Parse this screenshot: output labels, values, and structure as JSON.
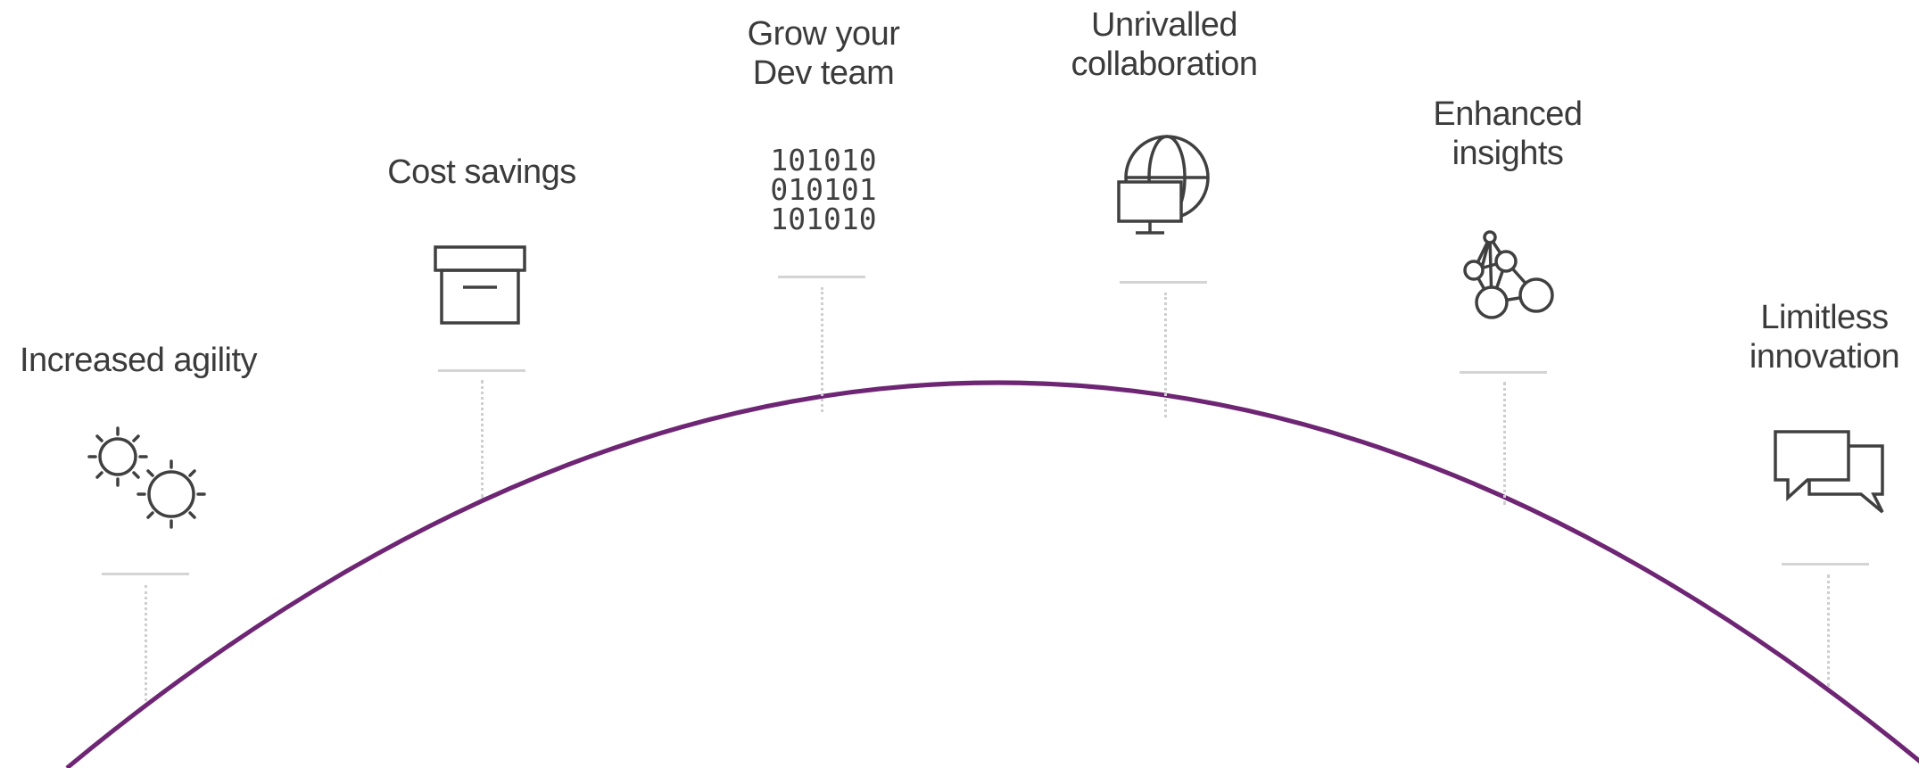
{
  "colors": {
    "arc": "#6e2574",
    "icon": "#404040",
    "connector": "#d4d4d4",
    "text": "#3b3b3b"
  },
  "benefits": [
    {
      "lines": [
        "Increased agility"
      ],
      "icon": "gears-icon"
    },
    {
      "lines": [
        "Cost savings"
      ],
      "icon": "archive-box-icon"
    },
    {
      "lines": [
        "Grow your",
        "Dev team"
      ],
      "icon": "binary-code-icon"
    },
    {
      "lines": [
        "Unrivalled",
        "collaboration"
      ],
      "icon": "globe-monitor-icon"
    },
    {
      "lines": [
        "Enhanced",
        "insights"
      ],
      "icon": "network-nodes-icon"
    },
    {
      "lines": [
        "Limitless",
        "innovation"
      ],
      "icon": "chat-bubbles-icon"
    }
  ],
  "binary": [
    "101010",
    "010101",
    "101010"
  ]
}
